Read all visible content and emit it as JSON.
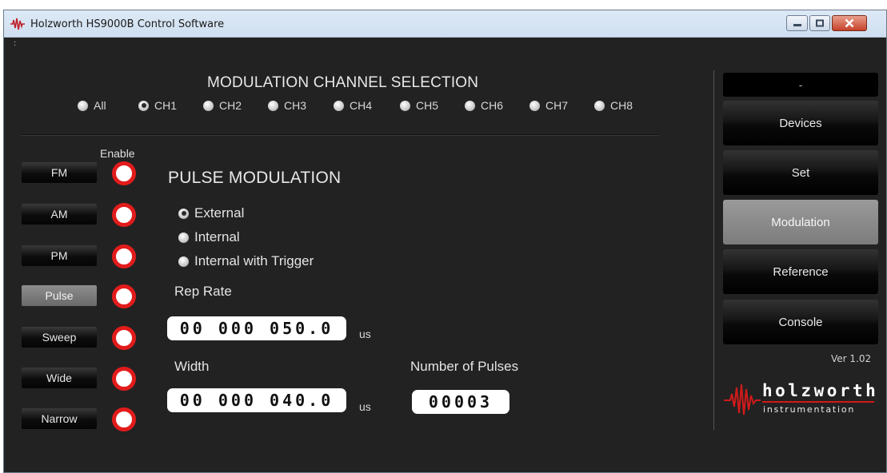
{
  "window": {
    "title": "Holzworth HS9000B Control Software"
  },
  "channel_selection": {
    "title": "MODULATION CHANNEL SELECTION",
    "options": [
      "All",
      "CH1",
      "CH2",
      "CH3",
      "CH4",
      "CH5",
      "CH6",
      "CH7",
      "CH8"
    ],
    "selected": "CH1"
  },
  "modes": {
    "enable_label": "Enable",
    "items": [
      {
        "label": "FM",
        "active": false
      },
      {
        "label": "AM",
        "active": false
      },
      {
        "label": "PM",
        "active": false
      },
      {
        "label": "Pulse",
        "active": true
      },
      {
        "label": "Sweep",
        "active": false
      },
      {
        "label": "Wide",
        "active": false
      },
      {
        "label": "Narrow",
        "active": false
      }
    ]
  },
  "pulse": {
    "title": "PULSE MODULATION",
    "options": [
      "External",
      "Internal",
      "Internal with Trigger"
    ],
    "selected": "External",
    "rep_rate": {
      "label": "Rep Rate",
      "value": "00 000 050.0",
      "unit": "us"
    },
    "width": {
      "label": "Width",
      "value": "00 000 040.0",
      "unit": "us"
    },
    "num_pulses": {
      "label": "Number of Pulses",
      "value": "00003"
    }
  },
  "sidebar": {
    "status": "-",
    "buttons": [
      {
        "label": "Devices",
        "active": false
      },
      {
        "label": "Set",
        "active": false
      },
      {
        "label": "Modulation",
        "active": true
      },
      {
        "label": "Reference",
        "active": false
      },
      {
        "label": "Console",
        "active": false
      }
    ],
    "version": "Ver 1.02",
    "brand_name": "holzworth",
    "brand_sub": "instrumentation"
  },
  "colors": {
    "background": "#222222",
    "accent_red": "#e21b1b",
    "active_button": "#7c7c7c"
  },
  "icons": [
    "app-logo-icon",
    "minimize-icon",
    "maximize-icon",
    "close-icon",
    "holzworth-wave-logo"
  ]
}
